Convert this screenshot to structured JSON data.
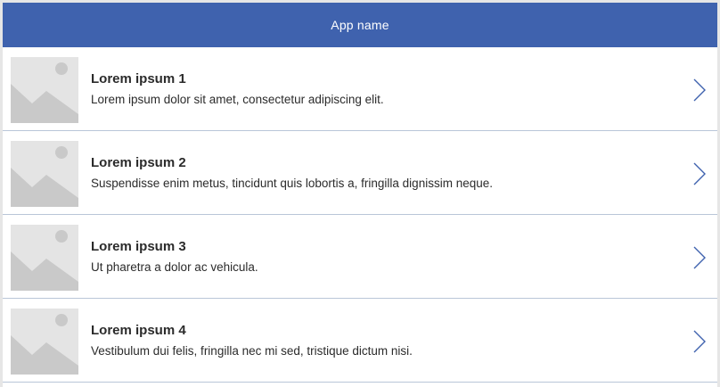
{
  "header": {
    "app_name": "App name"
  },
  "colors": {
    "header_bg": "#3f62ae",
    "divider": "#b9c6d8",
    "chevron": "#3f62ae"
  },
  "list": {
    "items": [
      {
        "title": "Lorem ipsum 1",
        "subtitle": "Lorem ipsum dolor sit amet, consectetur adipiscing elit.",
        "icon": "image-placeholder-icon",
        "nav_icon": "chevron-right-icon"
      },
      {
        "title": "Lorem ipsum 2",
        "subtitle": "Suspendisse enim metus, tincidunt quis lobortis a, fringilla dignissim neque.",
        "icon": "image-placeholder-icon",
        "nav_icon": "chevron-right-icon"
      },
      {
        "title": "Lorem ipsum 3",
        "subtitle": "Ut pharetra a dolor ac vehicula.",
        "icon": "image-placeholder-icon",
        "nav_icon": "chevron-right-icon"
      },
      {
        "title": "Lorem ipsum 4",
        "subtitle": "Vestibulum dui felis, fringilla nec mi sed, tristique dictum nisi.",
        "icon": "image-placeholder-icon",
        "nav_icon": "chevron-right-icon"
      }
    ]
  }
}
